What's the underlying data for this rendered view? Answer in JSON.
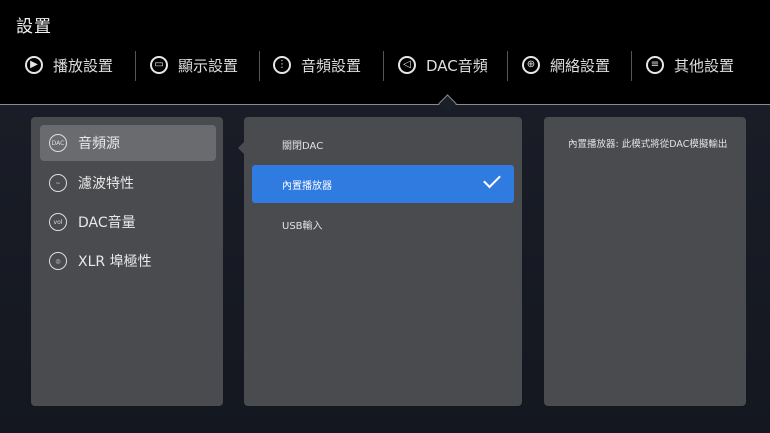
{
  "header": {
    "title": "設置"
  },
  "tabs": [
    {
      "label": "播放設置",
      "icon": "play-icon"
    },
    {
      "label": "顯示設置",
      "icon": "display-icon"
    },
    {
      "label": "音頻設置",
      "icon": "audio-wave-icon"
    },
    {
      "label": "DAC音頻",
      "icon": "speaker-icon"
    },
    {
      "label": "網絡設置",
      "icon": "globe-icon"
    },
    {
      "label": "其他設置",
      "icon": "menu-icon"
    }
  ],
  "active_tab": "DAC音頻",
  "menu": {
    "items": [
      {
        "label": "音頻源",
        "icon_text": "DAC",
        "icon": "dac-icon"
      },
      {
        "label": "濾波特性",
        "icon_text": "~",
        "icon": "filter-icon"
      },
      {
        "label": "DAC音量",
        "icon_text": "vol",
        "icon": "volume-icon"
      },
      {
        "label": "XLR 埠極性",
        "icon_text": "◎",
        "icon": "polarity-icon"
      }
    ],
    "active": "音頻源"
  },
  "options": {
    "items": [
      {
        "label": "關閉DAC"
      },
      {
        "label": "內置播放器"
      },
      {
        "label": "USB輸入"
      }
    ],
    "selected": "內置播放器"
  },
  "description": {
    "text": "內置播放器: 此模式將從DAC模擬輸出"
  },
  "colors": {
    "accent": "#2f7be0",
    "panel": "#4a4b4e",
    "background": "#000000"
  }
}
